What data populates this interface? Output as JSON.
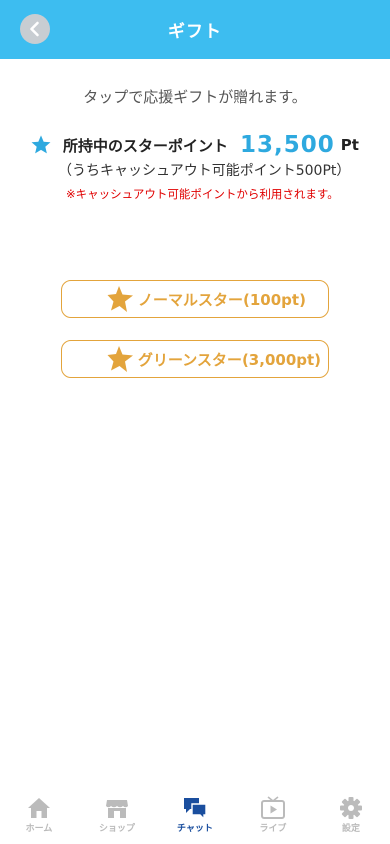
{
  "header": {
    "title": "ギフト"
  },
  "intro_text": "タップで応援ギフトが贈れます。",
  "points": {
    "label": "所持中のスターポイント",
    "value": "13,500",
    "unit": "Pt",
    "cashout_note": "（うちキャッシュアウト可能ポイント500Pt）",
    "notice": "※キャッシュアウト可能ポイントから利用されます。"
  },
  "gifts": [
    {
      "label": "ノーマルスター(100pt)"
    },
    {
      "label": "グリーンスター(3,000pt)"
    }
  ],
  "tabbar": {
    "items": [
      {
        "label": "ホーム",
        "icon": "home-icon"
      },
      {
        "label": "ショップ",
        "icon": "shop-icon"
      },
      {
        "label": "チャット",
        "icon": "chat-icon",
        "active": true
      },
      {
        "label": "ライブ",
        "icon": "live-icon"
      },
      {
        "label": "設定",
        "icon": "gear-icon"
      }
    ]
  },
  "colors": {
    "header": "#3dbdf0",
    "accent_blue": "#2ea9df",
    "gift_orange": "#e3a43c",
    "notice_red": "#e00000",
    "active_tab": "#1a4e9e",
    "inactive_tab": "#bbbbbb"
  }
}
